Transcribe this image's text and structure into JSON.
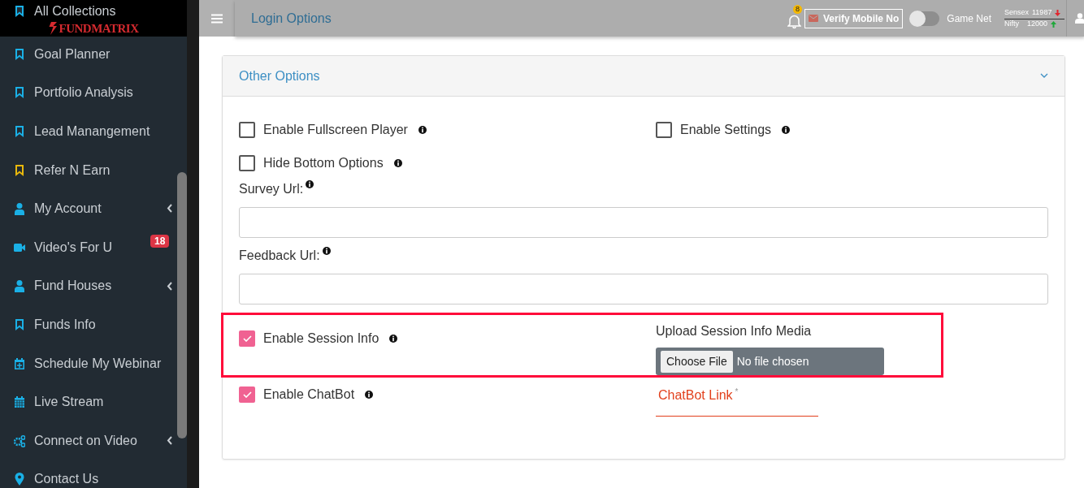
{
  "sidebar": {
    "logo": "FUNDMATRIX",
    "items": [
      {
        "label": "All Collections",
        "kind": "bookmark",
        "color": "#1ab0e6",
        "submenu": false
      },
      {
        "label": "Goal Planner",
        "kind": "bookmark",
        "color": "#1ab0e6",
        "submenu": false
      },
      {
        "label": "Portfolio Analysis",
        "kind": "bookmark",
        "color": "#1ab0e6",
        "submenu": false
      },
      {
        "label": "Lead Manangement",
        "kind": "bookmark",
        "color": "#1ab0e6",
        "submenu": false
      },
      {
        "label": "Refer N Earn",
        "kind": "bookmark",
        "color": "#e8b80c",
        "submenu": false
      },
      {
        "label": "My Account",
        "kind": "user",
        "color": "#1ab0e6",
        "submenu": true
      },
      {
        "label": "Video's For U",
        "kind": "video",
        "color": "#1ab0e6",
        "submenu": false,
        "badge": "18"
      },
      {
        "label": "Fund Houses",
        "kind": "user",
        "color": "#1ab0e6",
        "submenu": true
      },
      {
        "label": "Funds Info",
        "kind": "bookmark",
        "color": "#1ab0e6",
        "submenu": false
      },
      {
        "label": "Schedule My Webinar",
        "kind": "calendarplus",
        "color": "#1ab0e6",
        "submenu": false
      },
      {
        "label": "Live Stream",
        "kind": "calendar",
        "color": "#1ab0e6",
        "submenu": false
      },
      {
        "label": "Connect on Video",
        "kind": "gears",
        "color": "#1ab0e6",
        "submenu": true
      },
      {
        "label": "Contact Us",
        "kind": "pin",
        "color": "#1ab0e6",
        "submenu": false
      }
    ]
  },
  "header": {
    "title": "Login Options",
    "notifications": "8",
    "verify_button": "Verify Mobile No",
    "toggle": {
      "label": "Game Net",
      "on": false
    },
    "ticker": [
      {
        "name": "Sensex",
        "value": "11987",
        "rising": false
      },
      {
        "name": "Nifty",
        "value": "12000",
        "rising": true
      }
    ]
  },
  "panel": {
    "title": "Other Options",
    "expanded": true,
    "rows": [
      {
        "highlighted": false,
        "cells": [
          {
            "kind": "checkbox",
            "label": "Enable Fullscreen Player",
            "checked": false
          },
          {
            "kind": "checkbox",
            "label": "Enable Settings",
            "checked": false
          }
        ]
      },
      {
        "highlighted": false,
        "cells": [
          {
            "kind": "checkbox",
            "label": "Hide Bottom Options",
            "checked": false
          }
        ]
      },
      {
        "highlighted": false,
        "cells": [
          {
            "kind": "text",
            "label": "Survey Url:"
          }
        ]
      },
      {
        "highlighted": false,
        "cells": [
          {
            "kind": "text",
            "label": "Feedback Url:"
          }
        ]
      },
      {
        "highlighted": true,
        "cells": [
          {
            "kind": "checkbox",
            "label": "Enable Session Info",
            "checked": true
          },
          {
            "kind": "file",
            "label": "Upload Session Info Media",
            "button": "Choose File",
            "status": "No file chosen"
          }
        ]
      },
      {
        "highlighted": false,
        "cells": [
          {
            "kind": "checkbox",
            "label": "Enable ChatBot",
            "checked": true
          },
          {
            "kind": "underline",
            "label": "ChatBot Link",
            "required": "*"
          }
        ]
      }
    ]
  }
}
